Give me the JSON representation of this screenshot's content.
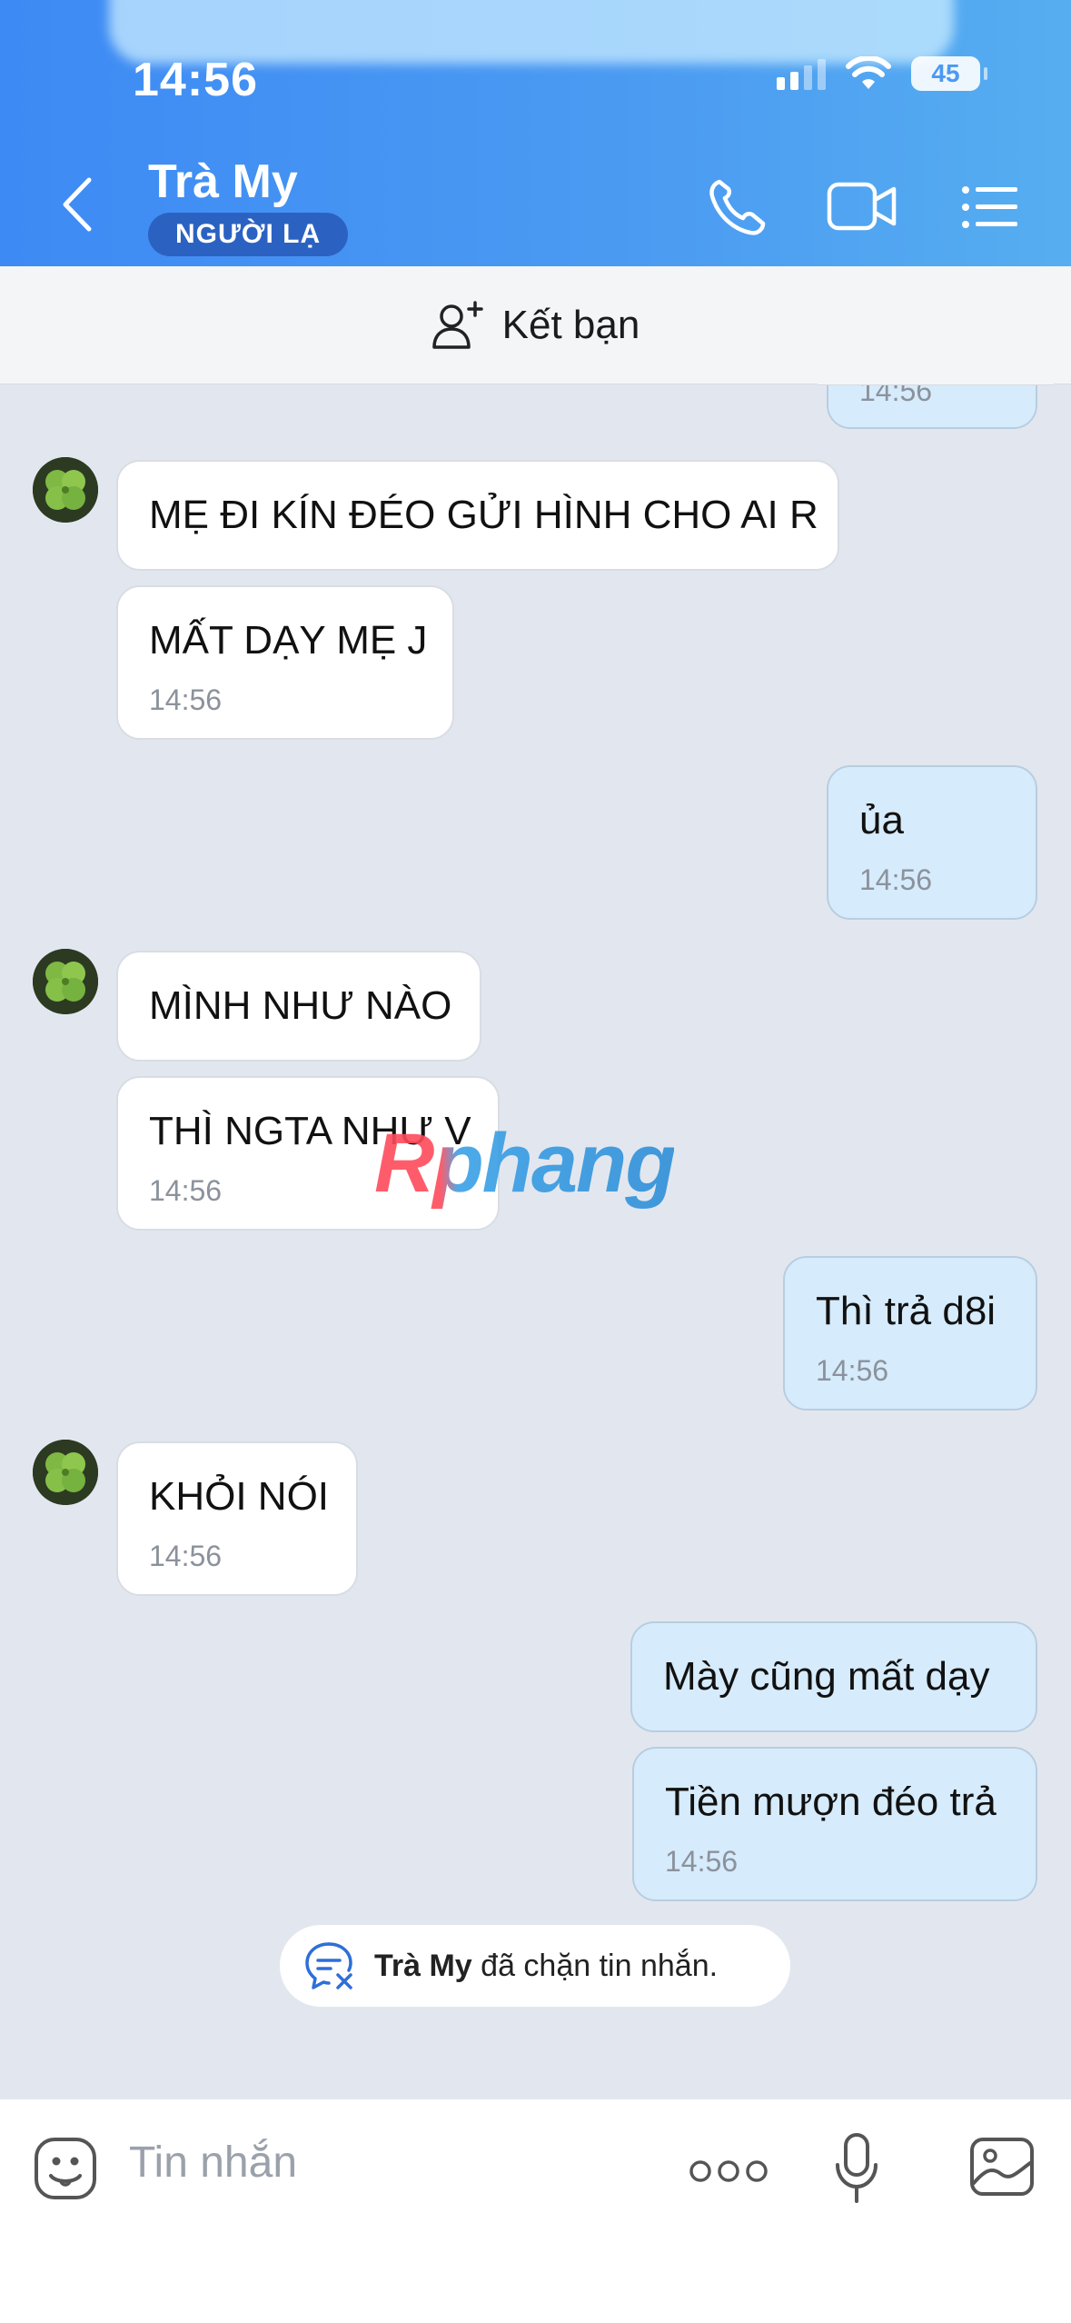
{
  "status_bar": {
    "time": "14:56",
    "battery": "45"
  },
  "header": {
    "contact_name": "Trà My",
    "badge": "NGƯỜI LẠ"
  },
  "add_friend": {
    "label": "Kết bạn"
  },
  "messages": {
    "top_partial_time": "14:56",
    "m1": {
      "text": "MẸ ĐI KÍN ĐÉO GỬI HÌNH CHO AI R"
    },
    "m2": {
      "text": "MẤT DẠY MẸ J",
      "time": "14:56"
    },
    "m3": {
      "text": "ủa",
      "time": "14:56"
    },
    "m4": {
      "text": "MÌNH NHƯ NÀO"
    },
    "m5": {
      "text": "THÌ NGTA NHƯ V",
      "time": "14:56"
    },
    "m6": {
      "text": "Thì trả d8i",
      "time": "14:56"
    },
    "m7": {
      "text": "KHỎI NÓI",
      "time": "14:56"
    },
    "m8": {
      "text": "Mày cũng mất dạy"
    },
    "m9": {
      "text": "Tiền mượn đéo trả",
      "time": "14:56"
    }
  },
  "blocked_notice": {
    "name": "Trà My",
    "text": "đã chặn tin nhắn."
  },
  "watermark": "Rphang",
  "input": {
    "placeholder": "Tin nhắn"
  }
}
